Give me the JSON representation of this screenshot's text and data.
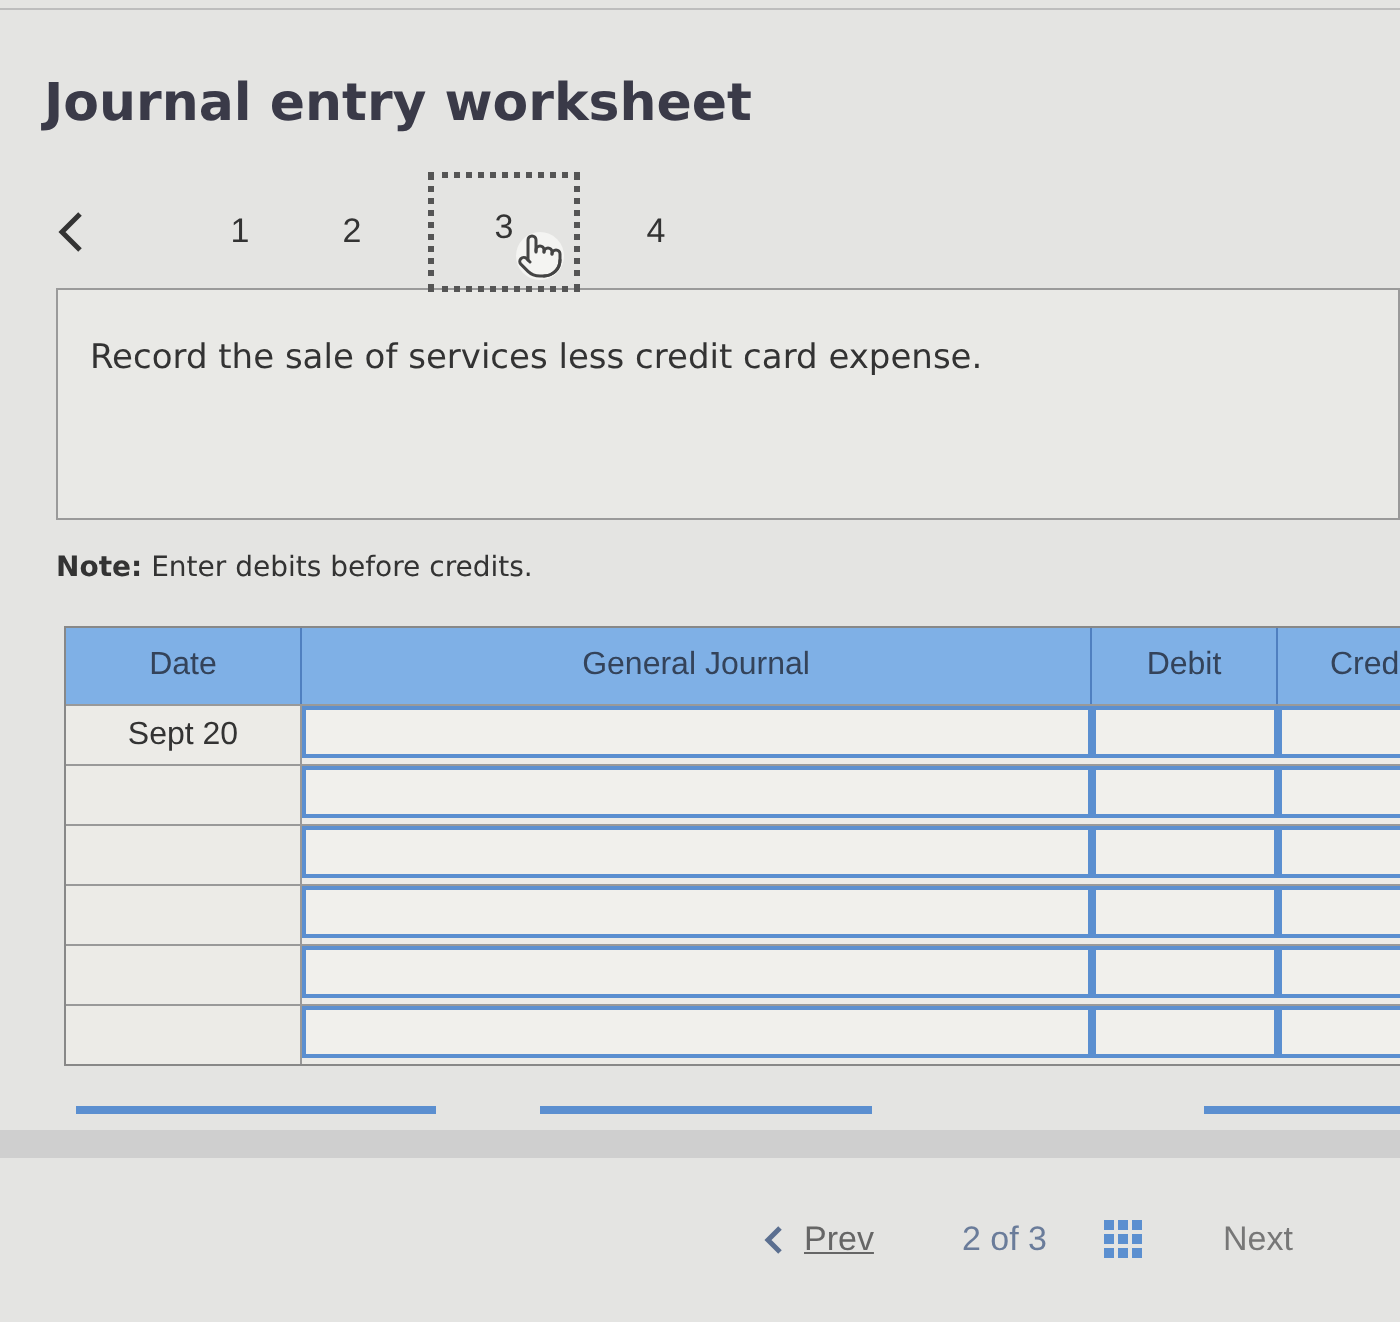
{
  "title": "Journal entry worksheet",
  "steps": [
    {
      "label": "1",
      "selected": false
    },
    {
      "label": "2",
      "selected": false
    },
    {
      "label": "3",
      "selected": true
    },
    {
      "label": "4",
      "selected": false
    }
  ],
  "instruction": "Record the sale of services less credit card expense.",
  "note": "**Note:** Enter debits before credits.",
  "table": {
    "columns": [
      "Date",
      "General Journal",
      "Debit",
      "Cred"
    ],
    "rows": [
      {
        "date": "Sept 20"
      },
      {},
      {},
      {},
      {},
      {}
    ]
  },
  "pager": {
    "prev": "Prev",
    "position": "2 of 3",
    "next": "Next"
  }
}
